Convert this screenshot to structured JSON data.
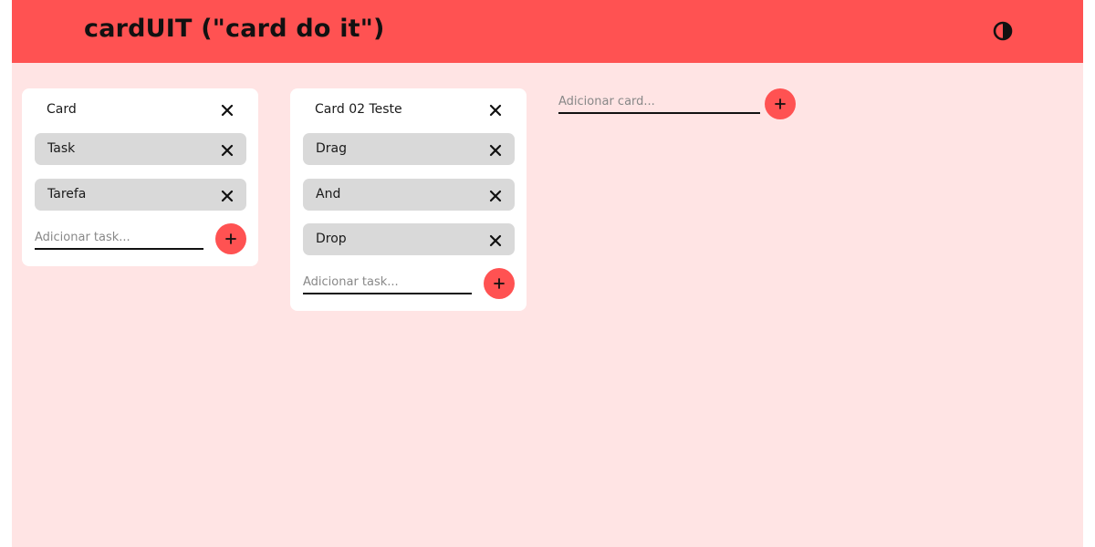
{
  "header": {
    "title": "cardUIT (\"card do it\")",
    "theme_toggle_icon": "contrast-icon"
  },
  "cards": [
    {
      "title": "Card",
      "tasks": [
        {
          "label": "Task"
        },
        {
          "label": "Tarefa"
        }
      ],
      "add_task_placeholder": "Adicionar task..."
    },
    {
      "title": "Card 02 Teste",
      "tasks": [
        {
          "label": "Drag"
        },
        {
          "label": "And"
        },
        {
          "label": "Drop"
        }
      ],
      "add_task_placeholder": "Adicionar task..."
    }
  ],
  "add_card": {
    "placeholder": "Adicionar card..."
  },
  "colors": {
    "header_bg": "#ff5252",
    "board_bg": "#ffe4e4",
    "card_bg": "#ffffff",
    "task_bg": "#d9d9d9",
    "accent": "#ff5252"
  }
}
